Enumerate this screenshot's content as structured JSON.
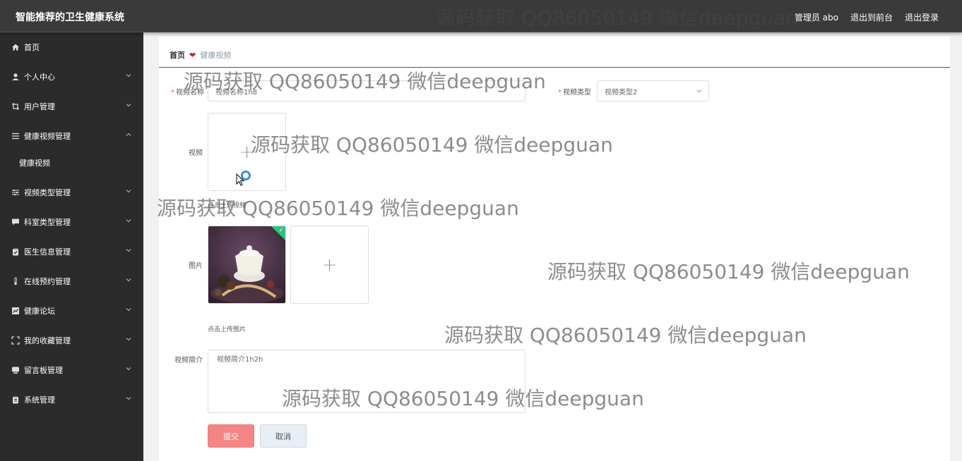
{
  "app": {
    "title": "智能推荐的卫生健康系统"
  },
  "header": {
    "user_label": "管理员 abo",
    "front_link": "退出到前台",
    "logout_link": "退出登录"
  },
  "sidebar": {
    "items": [
      {
        "label": "首页",
        "icon": "home-icon",
        "has_arrow": false
      },
      {
        "label": "个人中心",
        "icon": "user-icon",
        "has_arrow": true
      },
      {
        "label": "用户管理",
        "icon": "crop-icon",
        "has_arrow": true
      },
      {
        "label": "健康视频管理",
        "icon": "list-icon",
        "has_arrow": true,
        "expanded": true
      },
      {
        "label": "视频类型管理",
        "icon": "sliders-icon",
        "has_arrow": true
      },
      {
        "label": "科室类型管理",
        "icon": "chat-icon",
        "has_arrow": true
      },
      {
        "label": "医生信息管理",
        "icon": "clipboard-icon",
        "has_arrow": true
      },
      {
        "label": "在线预约管理",
        "icon": "thermometer-icon",
        "has_arrow": true
      },
      {
        "label": "健康论坛",
        "icon": "chart-icon",
        "has_arrow": true
      },
      {
        "label": "我的收藏管理",
        "icon": "fullscreen-icon",
        "has_arrow": true
      },
      {
        "label": "留言板管理",
        "icon": "message-icon",
        "has_arrow": true
      },
      {
        "label": "系统管理",
        "icon": "settings-icon",
        "has_arrow": true
      }
    ],
    "submenu": {
      "label": "健康视频"
    }
  },
  "breadcrumb": {
    "home": "首页",
    "current": "健康视频"
  },
  "form": {
    "name_label": "视频名称",
    "name_value": "视频名称1h8",
    "type_label": "视频类型",
    "type_value": "视频类型2",
    "video_label": "视频",
    "video_hint": "点击上传视频",
    "image_label": "图片",
    "image_hint": "点击上传图片",
    "intro_label": "视频简介",
    "intro_value": "视频简介1h2h",
    "submit_label": "提交",
    "cancel_label": "取消"
  },
  "watermarks": [
    "源码获取 QQ86050149 微信deepguan",
    "源码获取 QQ86050149 微信deepguan",
    "源码获取 QQ86050149 微信deepguan",
    "源码获取 QQ86050149 微信deepguan",
    "源码获取 QQ86050149 微信deepguan",
    "源码获取 QQ86050149 微信deepguan",
    "源码获取 QQ86050149 微信deepguan"
  ],
  "colors": {
    "topbar": "#3a3a3a",
    "sidebar": "#2b2b2b",
    "submit": "#f48585",
    "heart": "#c0282d",
    "success": "#2ec27e"
  }
}
